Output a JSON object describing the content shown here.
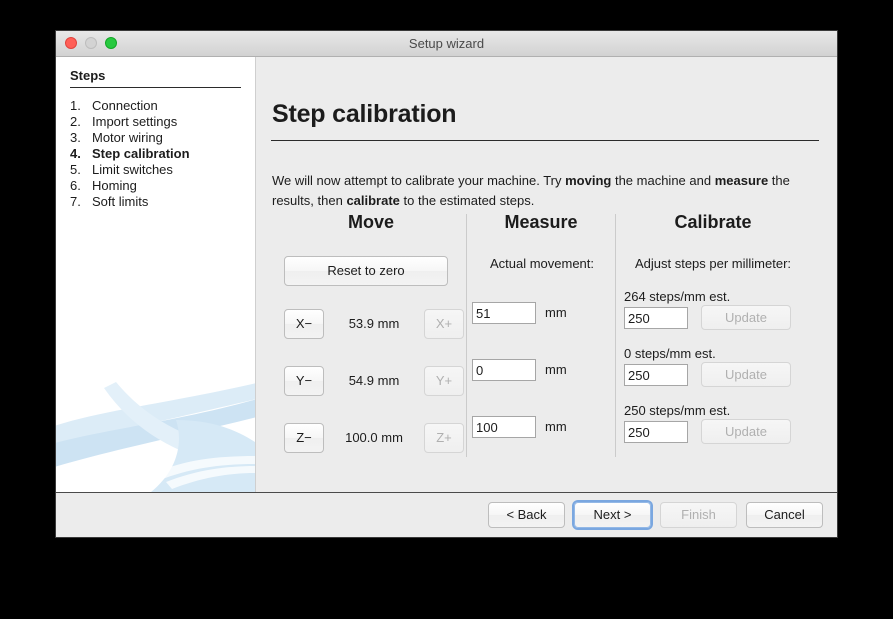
{
  "window": {
    "title": "Setup wizard",
    "controls": [
      {
        "name": "close",
        "color": "#ff5f57"
      },
      {
        "name": "minimize",
        "color": "#d3d3d3"
      },
      {
        "name": "zoom",
        "color": "#28c940"
      }
    ]
  },
  "sidebar": {
    "heading": "Steps",
    "items": [
      {
        "num": "1.",
        "label": "Connection",
        "current": false
      },
      {
        "num": "2.",
        "label": "Import settings",
        "current": false
      },
      {
        "num": "3.",
        "label": "Motor wiring",
        "current": false
      },
      {
        "num": "4.",
        "label": "Step calibration",
        "current": true
      },
      {
        "num": "5.",
        "label": "Limit switches",
        "current": false
      },
      {
        "num": "6.",
        "label": "Homing",
        "current": false
      },
      {
        "num": "7.",
        "label": "Soft limits",
        "current": false
      }
    ]
  },
  "main": {
    "title": "Step calibration",
    "intro_line1_a": "We will now attempt to calibrate your machine. Try ",
    "intro_line1_b": "moving",
    "intro_line1_c": " the machine and",
    "intro_line2_a": "measure",
    "intro_line2_b": " the results, then ",
    "intro_line2_c": "calibrate",
    "intro_line2_d": " to the estimated steps.",
    "columns": {
      "move": "Move",
      "measure": "Measure",
      "calibrate": "Calibrate"
    },
    "move": {
      "reset_label": "Reset to zero",
      "axes": [
        {
          "minus": "X−",
          "value": "53.9 mm",
          "plus": "X+",
          "plus_disabled": true
        },
        {
          "minus": "Y−",
          "value": "54.9 mm",
          "plus": "Y+",
          "plus_disabled": true
        },
        {
          "minus": "Z−",
          "value": "100.0 mm",
          "plus": "Z+",
          "plus_disabled": true
        }
      ]
    },
    "measure": {
      "label": "Actual movement:",
      "rows": [
        {
          "value": "51",
          "unit": "mm"
        },
        {
          "value": "0",
          "unit": "mm"
        },
        {
          "value": "100",
          "unit": "mm"
        }
      ]
    },
    "calibrate": {
      "label": "Adjust steps per millimeter:",
      "rows": [
        {
          "est": "264 steps/mm est.",
          "value": "250",
          "update": "Update",
          "update_disabled": true
        },
        {
          "est": "0 steps/mm est.",
          "value": "250",
          "update": "Update",
          "update_disabled": true
        },
        {
          "est": "250 steps/mm est.",
          "value": "250",
          "update": "Update",
          "update_disabled": true
        }
      ]
    }
  },
  "footer": {
    "back": "< Back",
    "next": "Next >",
    "finish": "Finish",
    "cancel": "Cancel"
  },
  "colors": {
    "window_bg": "#ececec",
    "sidebar_bg": "#ffffff",
    "focus_ring": "#7aa7e0",
    "swoosh": "#cfe4f2"
  }
}
